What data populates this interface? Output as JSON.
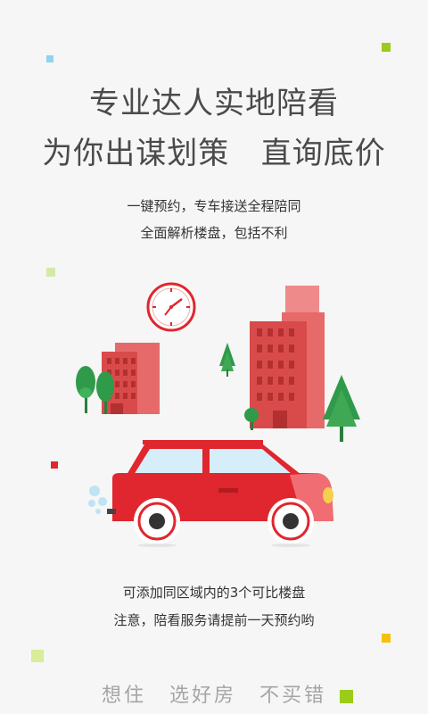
{
  "headline": {
    "line1": "专业达人实地陪看",
    "line2": "为你出谋划策   直询底价"
  },
  "intro": {
    "line1": "一键预约，专车接送全程陪同",
    "line2": "全面解析楼盘，包括不利"
  },
  "notes": {
    "line1": "可添加同区域内的3个可比楼盘",
    "line2": "注意，陪看服务请提前一天预约哟"
  },
  "slogan": {
    "part1": "想住",
    "part2": "选好房",
    "part3": "不买错"
  },
  "illustration": {
    "icons": [
      "clock-icon",
      "building-icon",
      "tree-icon",
      "car-icon"
    ]
  },
  "colors": {
    "background": "#f5f6f5",
    "accent_red": "#e0262e",
    "building_red": "#e05a5a",
    "tree_green": "#2f9a4a",
    "square_green": "#9ccc1a",
    "square_yellow": "#f6c10a",
    "square_blue": "#8fd3f4"
  }
}
